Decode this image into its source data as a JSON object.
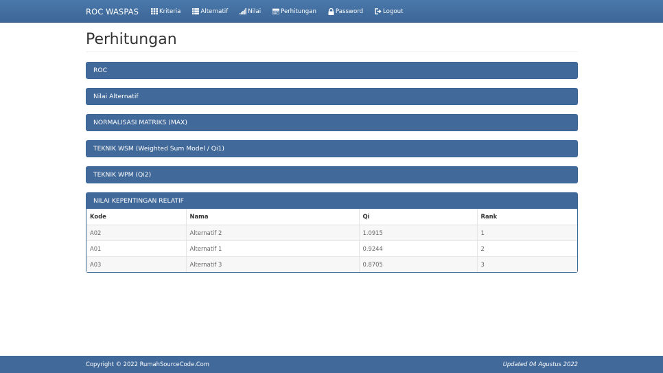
{
  "navbar": {
    "brand": "ROC WASPAS",
    "items": [
      {
        "label": "Kriteria",
        "icon": "th-icon"
      },
      {
        "label": "Alternatif",
        "icon": "list-icon"
      },
      {
        "label": "Nilai",
        "icon": "signal-icon"
      },
      {
        "label": "Perhitungan",
        "icon": "calendar-icon"
      },
      {
        "label": "Password",
        "icon": "lock-icon"
      },
      {
        "label": "Logout",
        "icon": "logout-icon"
      }
    ]
  },
  "page": {
    "title": "Perhitungan"
  },
  "panels": [
    {
      "title": "ROC"
    },
    {
      "title": "Nilai Alternatif"
    },
    {
      "title": "NORMALISASI MATRIKS (MAX)"
    },
    {
      "title": "TEKNIK WSM (Weighted Sum Model / Qi1)"
    },
    {
      "title": "TEKNIK WPM (Qi2)"
    },
    {
      "title": "NILAI KEPENTINGAN RELATIF"
    }
  ],
  "result_table": {
    "headers": [
      "Kode",
      "Nama",
      "Qi",
      "Rank"
    ],
    "rows": [
      [
        "A02",
        "Alternatif 2",
        "1.0915",
        "1"
      ],
      [
        "A01",
        "Alternatif 1",
        "0.9244",
        "2"
      ],
      [
        "A03",
        "Alternatif 3",
        "0.8705",
        "3"
      ]
    ]
  },
  "footer": {
    "copyright": "Copyright © 2022 RumahSourceCode.Com",
    "updated": "Updated 04 Agustus 2022"
  },
  "colors": {
    "navbar": "#3c6696",
    "panel_heading": "#41699a",
    "footer": "#41699a"
  }
}
